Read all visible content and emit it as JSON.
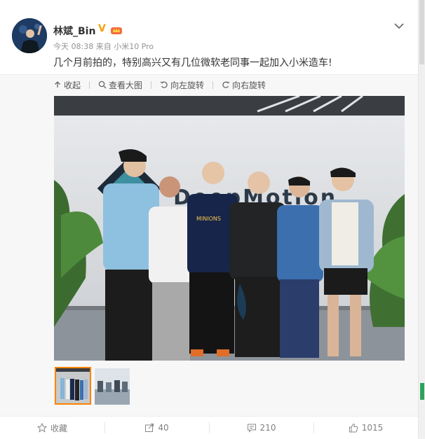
{
  "post": {
    "author": "林斌_Bin",
    "meta": "今天 08:38 来自 小米10 Pro",
    "text": "几个月前拍的，特别高兴又有几位微软老同事一起加入小米造车!"
  },
  "toolbar": {
    "collapse_label": "收起",
    "view_full_label": "查看大图",
    "rotate_left_label": "向左旋转",
    "rotate_right_label": "向右旋转"
  },
  "photo": {
    "sign_text": "DeepMotion"
  },
  "actions": {
    "favorite_label": "收藏",
    "repost_count": "40",
    "comment_count": "210",
    "like_count": "1015"
  },
  "colors": {
    "accent": "#ff8200",
    "verified": "#f5a20b",
    "text_muted": "#939393"
  }
}
